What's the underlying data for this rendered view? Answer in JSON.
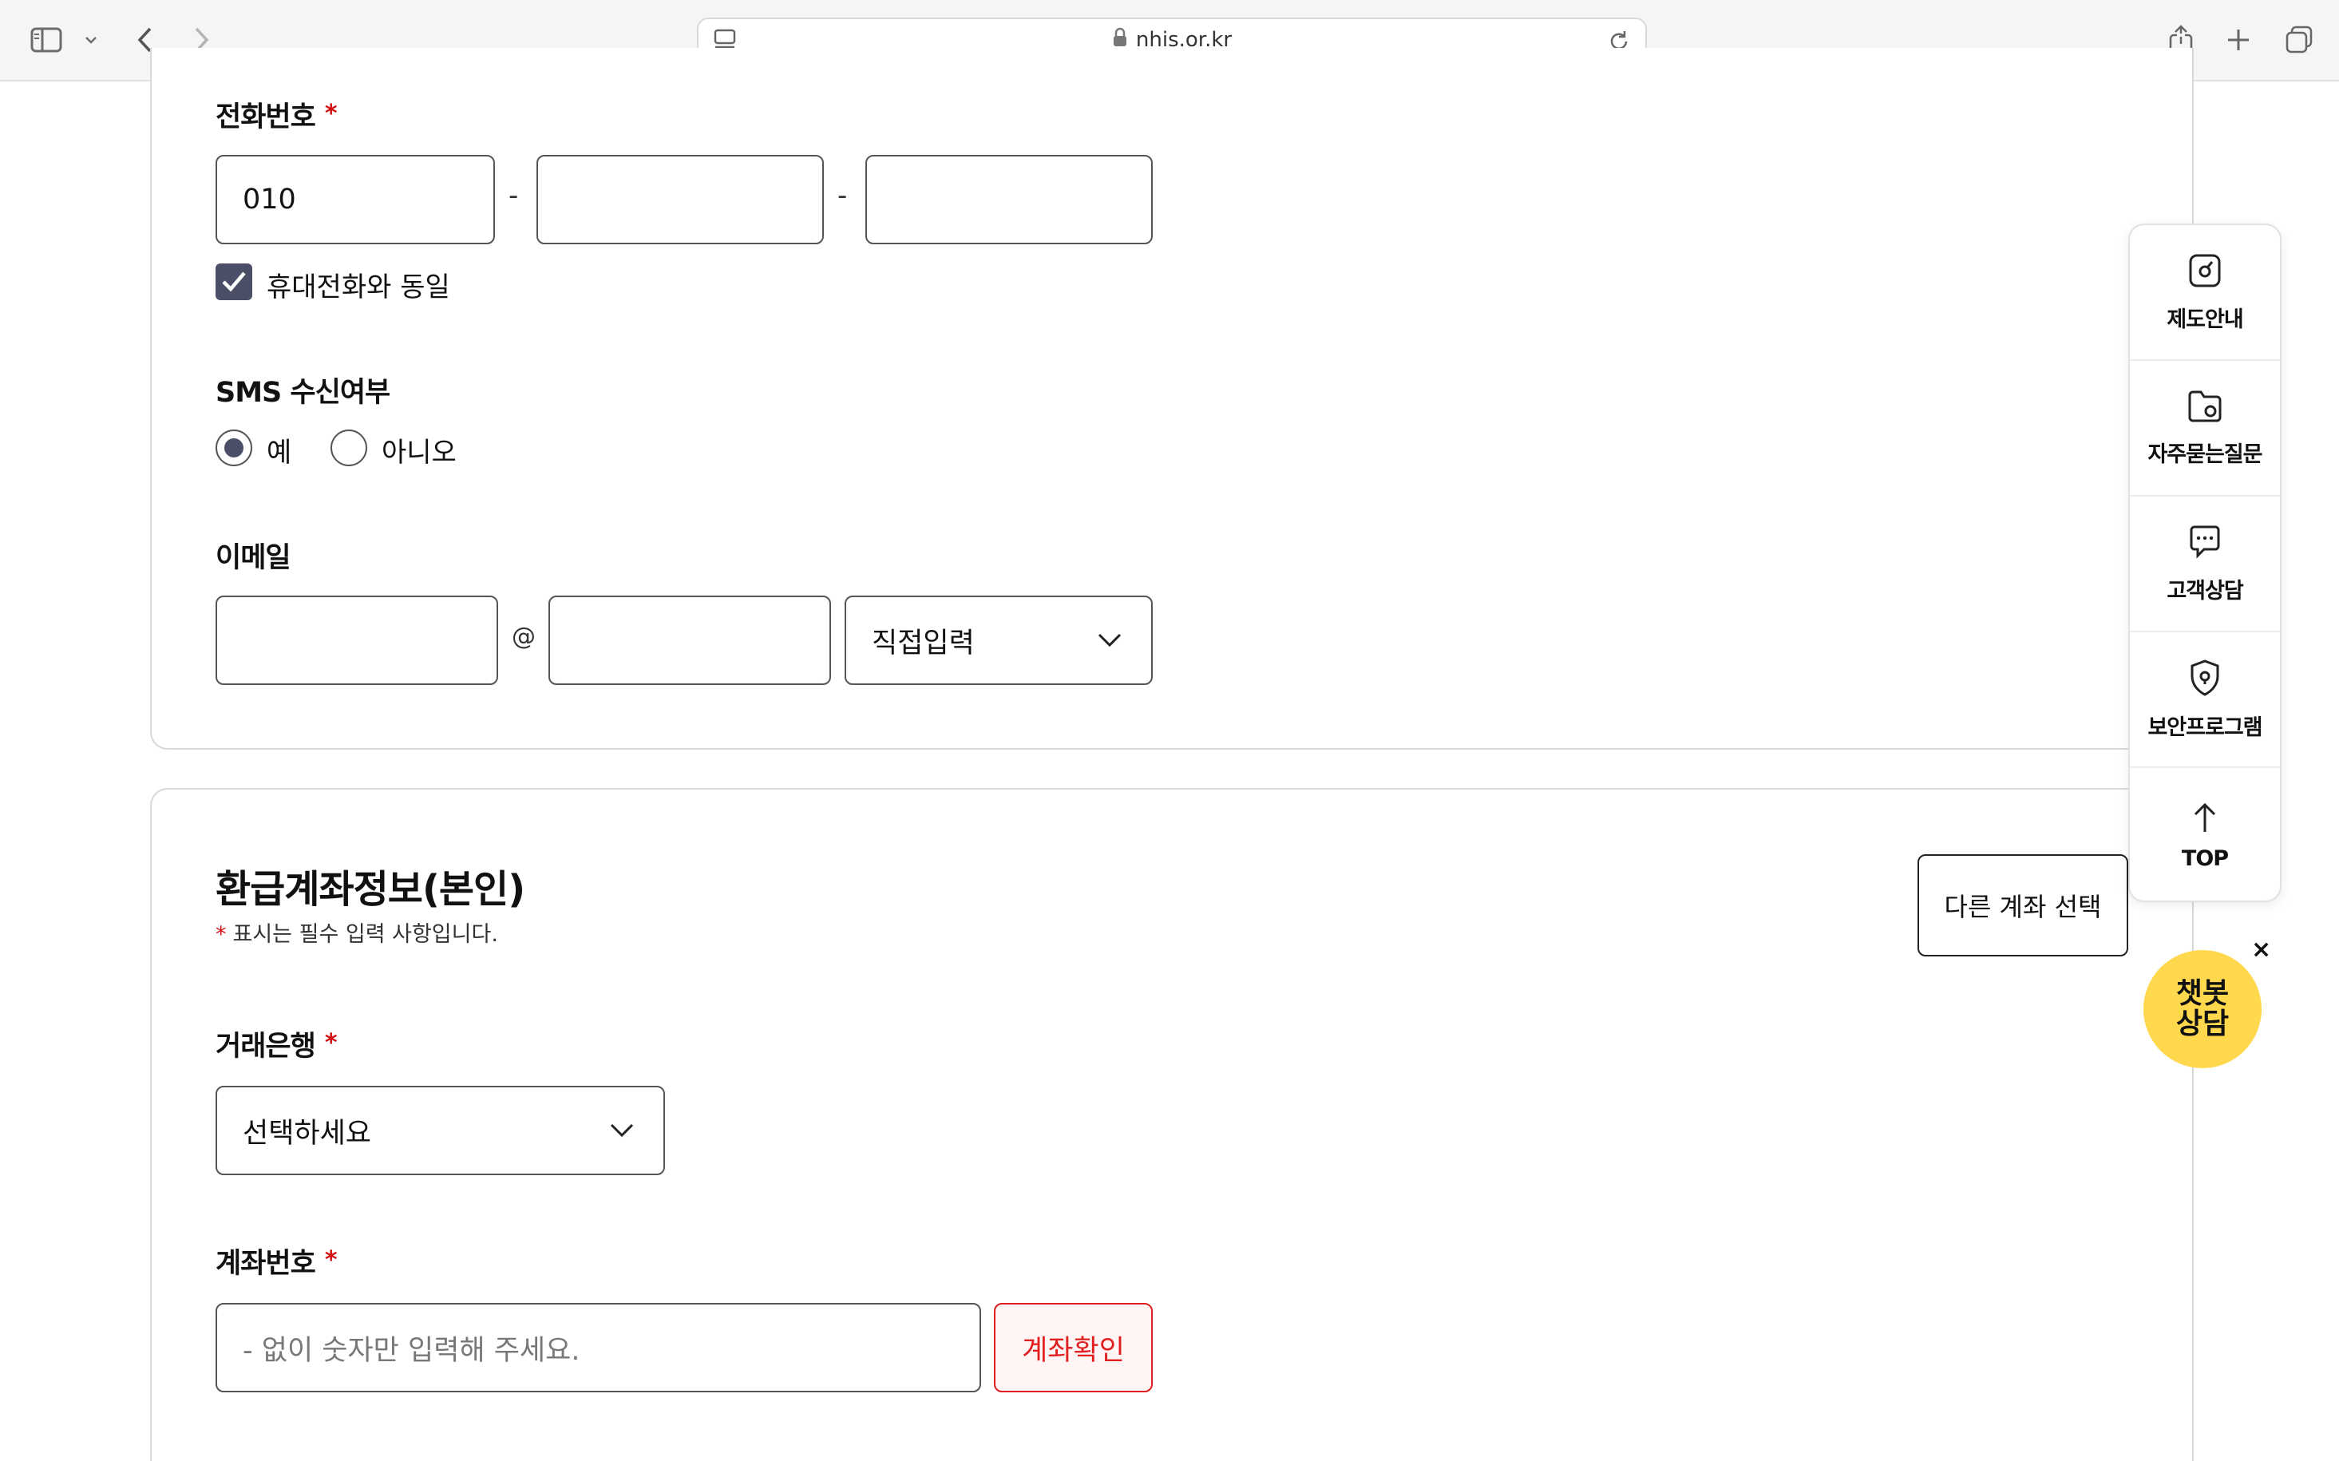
{
  "browser": {
    "url": "nhis.or.kr"
  },
  "contact": {
    "phone_label": "전화번호",
    "required_mark": "*",
    "phone_first": "010",
    "phone_middle": "",
    "phone_last": "",
    "phone_separator": "-",
    "same_as_mobile_label": "휴대전화와 동일",
    "same_as_mobile_checked": true,
    "sms_label": "SMS 수신여부",
    "sms_yes": "예",
    "sms_no": "아니오",
    "sms_selected": "예",
    "email_label": "이메일",
    "email_id": "",
    "email_at": "@",
    "email_domain": "",
    "email_domain_select": "직접입력"
  },
  "refund": {
    "title": "환급계좌정보(본인)",
    "required_note_star": "*",
    "required_note": "표시는 필수 입력 사항입니다.",
    "other_account_button": "다른 계좌 선택",
    "bank_label": "거래은행",
    "bank_select": "선택하세요",
    "account_label": "계좌번호",
    "account_placeholder": "- 없이 숫자만 입력해 주세요.",
    "verify_button": "계좌확인"
  },
  "quick_menu": {
    "items": [
      {
        "label": "제도안내",
        "icon": "guide-icon"
      },
      {
        "label": "자주묻는질문",
        "icon": "faq-folder-icon"
      },
      {
        "label": "고객상담",
        "icon": "chat-bubble-icon"
      },
      {
        "label": "보안프로그램",
        "icon": "shield-icon"
      },
      {
        "label": "TOP",
        "icon": "arrow-up-icon"
      }
    ]
  },
  "chatbot": {
    "label_line1": "챗봇",
    "label_line2": "상담",
    "close": "×",
    "color": "#ffd84d"
  },
  "colors": {
    "required": "#d30f0f",
    "control_fill": "#4a4e66",
    "verify_red": "#e02020"
  }
}
